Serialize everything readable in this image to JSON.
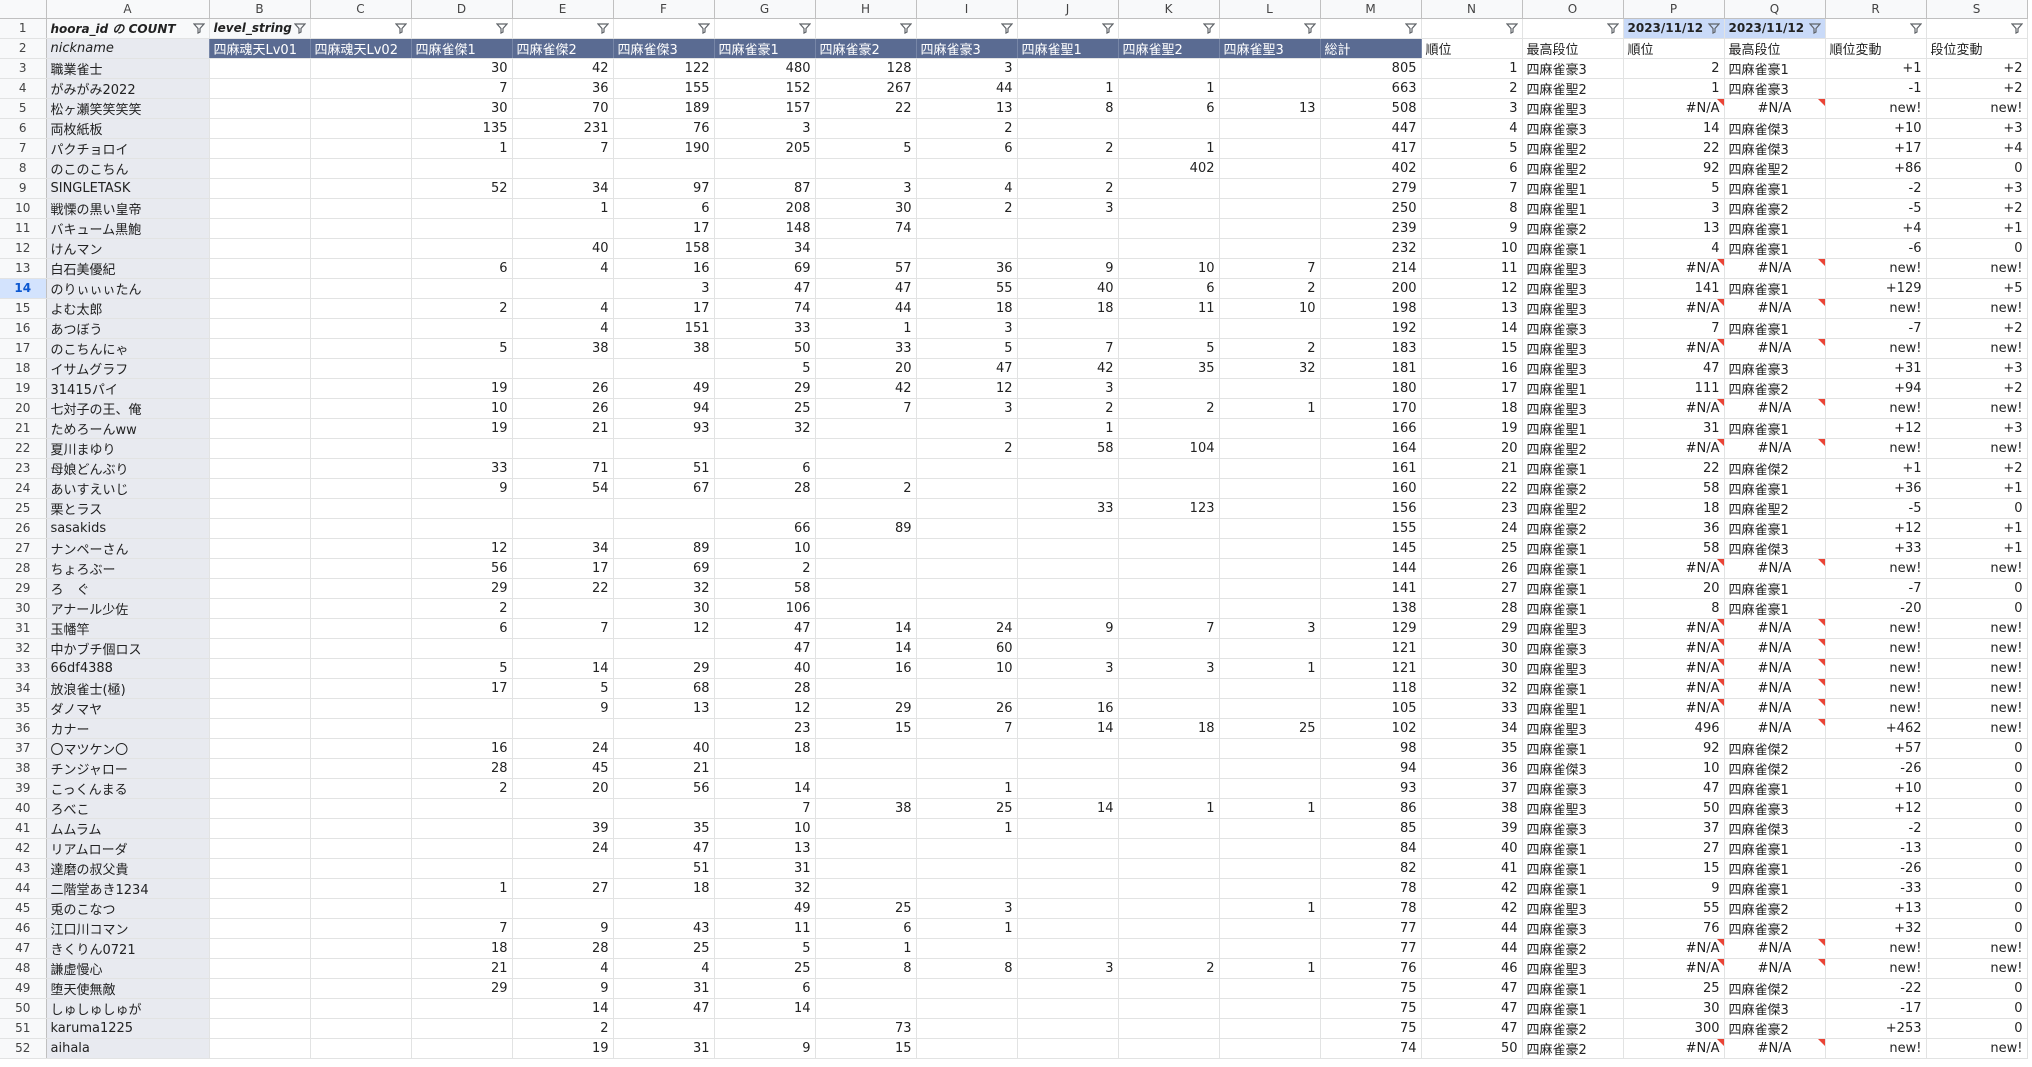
{
  "col_headers": [
    "A",
    "B",
    "C",
    "D",
    "E",
    "F",
    "G",
    "H",
    "I",
    "J",
    "K",
    "L",
    "M",
    "N",
    "O",
    "P",
    "Q",
    "R",
    "S"
  ],
  "row1": {
    "A": "hoora_id の COUNT",
    "B": "level_string",
    "P": "2023/11/12",
    "Q": "2023/11/12"
  },
  "row2": {
    "A": "nickname",
    "B": "四麻魂天Lv01",
    "C": "四麻魂天Lv02",
    "D": "四麻雀傑1",
    "E": "四麻雀傑2",
    "F": "四麻雀傑3",
    "G": "四麻雀豪1",
    "H": "四麻雀豪2",
    "I": "四麻雀豪3",
    "J": "四麻雀聖1",
    "K": "四麻雀聖2",
    "L": "四麻雀聖3",
    "M": "総計",
    "N": "順位",
    "O": "最高段位",
    "P": "順位",
    "Q": "最高段位",
    "R": "順位変動",
    "S": "段位変動"
  },
  "rows": [
    {
      "n": "3",
      "A": "職業雀士",
      "B": "",
      "C": "",
      "D": "30",
      "E": "42",
      "F": "122",
      "G": "480",
      "H": "128",
      "I": "3",
      "J": "",
      "K": "",
      "L": "",
      "M": "805",
      "N": "1",
      "O": "四麻雀豪3",
      "P": "2",
      "Q": "四麻雀豪1",
      "R": "+1",
      "S": "+2"
    },
    {
      "n": "4",
      "A": "がみがみ2022",
      "B": "",
      "C": "",
      "D": "7",
      "E": "36",
      "F": "155",
      "G": "152",
      "H": "267",
      "I": "44",
      "J": "1",
      "K": "1",
      "L": "",
      "M": "663",
      "N": "2",
      "O": "四麻雀聖2",
      "P": "1",
      "Q": "四麻雀豪3",
      "R": "-1",
      "S": "+2"
    },
    {
      "n": "5",
      "A": "松ヶ瀬笑笑笑笑",
      "B": "",
      "C": "",
      "D": "30",
      "E": "70",
      "F": "189",
      "G": "157",
      "H": "22",
      "I": "13",
      "J": "8",
      "K": "6",
      "L": "13",
      "M": "508",
      "N": "3",
      "O": "四麻雀聖3",
      "P": "#N/A",
      "Q": "#N/A",
      "R": "new!",
      "S": "new!"
    },
    {
      "n": "6",
      "A": "両枚紙板",
      "B": "",
      "C": "",
      "D": "135",
      "E": "231",
      "F": "76",
      "G": "3",
      "H": "",
      "I": "2",
      "J": "",
      "K": "",
      "L": "",
      "M": "447",
      "N": "4",
      "O": "四麻雀豪3",
      "P": "14",
      "Q": "四麻雀傑3",
      "R": "+10",
      "S": "+3"
    },
    {
      "n": "7",
      "A": "パクチョロイ",
      "B": "",
      "C": "",
      "D": "1",
      "E": "7",
      "F": "190",
      "G": "205",
      "H": "5",
      "I": "6",
      "J": "2",
      "K": "1",
      "L": "",
      "M": "417",
      "N": "5",
      "O": "四麻雀聖2",
      "P": "22",
      "Q": "四麻雀傑3",
      "R": "+17",
      "S": "+4"
    },
    {
      "n": "8",
      "A": "のこのこちん",
      "B": "",
      "C": "",
      "D": "",
      "E": "",
      "F": "",
      "G": "",
      "H": "",
      "I": "",
      "J": "",
      "K": "402",
      "L": "",
      "M": "402",
      "N": "6",
      "O": "四麻雀聖2",
      "P": "92",
      "Q": "四麻雀聖2",
      "R": "+86",
      "S": "0"
    },
    {
      "n": "9",
      "A": "SINGLETASK",
      "B": "",
      "C": "",
      "D": "52",
      "E": "34",
      "F": "97",
      "G": "87",
      "H": "3",
      "I": "4",
      "J": "2",
      "K": "",
      "L": "",
      "M": "279",
      "N": "7",
      "O": "四麻雀聖1",
      "P": "5",
      "Q": "四麻雀豪1",
      "R": "-2",
      "S": "+3"
    },
    {
      "n": "10",
      "A": "戦慄の黒い皇帝",
      "B": "",
      "C": "",
      "D": "",
      "E": "1",
      "F": "6",
      "G": "208",
      "H": "30",
      "I": "2",
      "J": "3",
      "K": "",
      "L": "",
      "M": "250",
      "N": "8",
      "O": "四麻雀聖1",
      "P": "3",
      "Q": "四麻雀豪2",
      "R": "-5",
      "S": "+2"
    },
    {
      "n": "11",
      "A": "バキューム黒鮑",
      "B": "",
      "C": "",
      "D": "",
      "E": "",
      "F": "17",
      "G": "148",
      "H": "74",
      "I": "",
      "J": "",
      "K": "",
      "L": "",
      "M": "239",
      "N": "9",
      "O": "四麻雀豪2",
      "P": "13",
      "Q": "四麻雀豪1",
      "R": "+4",
      "S": "+1"
    },
    {
      "n": "12",
      "A": "けんマン",
      "B": "",
      "C": "",
      "D": "",
      "E": "40",
      "F": "158",
      "G": "34",
      "H": "",
      "I": "",
      "J": "",
      "K": "",
      "L": "",
      "M": "232",
      "N": "10",
      "O": "四麻雀豪1",
      "P": "4",
      "Q": "四麻雀豪1",
      "R": "-6",
      "S": "0"
    },
    {
      "n": "13",
      "A": "白石美優紀",
      "B": "",
      "C": "",
      "D": "6",
      "E": "4",
      "F": "16",
      "G": "69",
      "H": "57",
      "I": "36",
      "J": "9",
      "K": "10",
      "L": "7",
      "M": "214",
      "N": "11",
      "O": "四麻雀聖3",
      "P": "#N/A",
      "Q": "#N/A",
      "R": "new!",
      "S": "new!"
    },
    {
      "n": "14",
      "A": "のりぃぃぃたん",
      "B": "",
      "C": "",
      "D": "",
      "E": "",
      "F": "3",
      "G": "47",
      "H": "47",
      "I": "55",
      "J": "40",
      "K": "6",
      "L": "2",
      "M": "200",
      "N": "12",
      "O": "四麻雀聖3",
      "P": "141",
      "Q": "四麻雀豪1",
      "R": "+129",
      "S": "+5"
    },
    {
      "n": "15",
      "A": "よむ太郎",
      "B": "",
      "C": "",
      "D": "2",
      "E": "4",
      "F": "17",
      "G": "74",
      "H": "44",
      "I": "18",
      "J": "18",
      "K": "11",
      "L": "10",
      "M": "198",
      "N": "13",
      "O": "四麻雀聖3",
      "P": "#N/A",
      "Q": "#N/A",
      "R": "new!",
      "S": "new!"
    },
    {
      "n": "16",
      "A": "あつぼう",
      "B": "",
      "C": "",
      "D": "",
      "E": "4",
      "F": "151",
      "G": "33",
      "H": "1",
      "I": "3",
      "J": "",
      "K": "",
      "L": "",
      "M": "192",
      "N": "14",
      "O": "四麻雀豪3",
      "P": "7",
      "Q": "四麻雀豪1",
      "R": "-7",
      "S": "+2"
    },
    {
      "n": "17",
      "A": "のこちんにゃ",
      "B": "",
      "C": "",
      "D": "5",
      "E": "38",
      "F": "38",
      "G": "50",
      "H": "33",
      "I": "5",
      "J": "7",
      "K": "5",
      "L": "2",
      "M": "183",
      "N": "15",
      "O": "四麻雀聖3",
      "P": "#N/A",
      "Q": "#N/A",
      "R": "new!",
      "S": "new!"
    },
    {
      "n": "18",
      "A": "イサムグラフ",
      "B": "",
      "C": "",
      "D": "",
      "E": "",
      "F": "",
      "G": "5",
      "H": "20",
      "I": "47",
      "J": "42",
      "K": "35",
      "L": "32",
      "M": "181",
      "N": "16",
      "O": "四麻雀聖3",
      "P": "47",
      "Q": "四麻雀豪3",
      "R": "+31",
      "S": "+3"
    },
    {
      "n": "19",
      "A": "31415パイ",
      "B": "",
      "C": "",
      "D": "19",
      "E": "26",
      "F": "49",
      "G": "29",
      "H": "42",
      "I": "12",
      "J": "3",
      "K": "",
      "L": "",
      "M": "180",
      "N": "17",
      "O": "四麻雀聖1",
      "P": "111",
      "Q": "四麻雀豪2",
      "R": "+94",
      "S": "+2"
    },
    {
      "n": "20",
      "A": "七対子の王、俺",
      "B": "",
      "C": "",
      "D": "10",
      "E": "26",
      "F": "94",
      "G": "25",
      "H": "7",
      "I": "3",
      "J": "2",
      "K": "2",
      "L": "1",
      "M": "170",
      "N": "18",
      "O": "四麻雀聖3",
      "P": "#N/A",
      "Q": "#N/A",
      "R": "new!",
      "S": "new!"
    },
    {
      "n": "21",
      "A": "ためろーんww",
      "B": "",
      "C": "",
      "D": "19",
      "E": "21",
      "F": "93",
      "G": "32",
      "H": "",
      "I": "",
      "J": "1",
      "K": "",
      "L": "",
      "M": "166",
      "N": "19",
      "O": "四麻雀聖1",
      "P": "31",
      "Q": "四麻雀豪1",
      "R": "+12",
      "S": "+3"
    },
    {
      "n": "22",
      "A": "夏川まゆり",
      "B": "",
      "C": "",
      "D": "",
      "E": "",
      "F": "",
      "G": "",
      "H": "",
      "I": "2",
      "J": "58",
      "K": "104",
      "L": "",
      "M": "164",
      "N": "20",
      "O": "四麻雀聖2",
      "P": "#N/A",
      "Q": "#N/A",
      "R": "new!",
      "S": "new!"
    },
    {
      "n": "23",
      "A": "母娘どんぶり",
      "B": "",
      "C": "",
      "D": "33",
      "E": "71",
      "F": "51",
      "G": "6",
      "H": "",
      "I": "",
      "J": "",
      "K": "",
      "L": "",
      "M": "161",
      "N": "21",
      "O": "四麻雀豪1",
      "P": "22",
      "Q": "四麻雀傑2",
      "R": "+1",
      "S": "+2"
    },
    {
      "n": "24",
      "A": "あいすえいじ",
      "B": "",
      "C": "",
      "D": "9",
      "E": "54",
      "F": "67",
      "G": "28",
      "H": "2",
      "I": "",
      "J": "",
      "K": "",
      "L": "",
      "M": "160",
      "N": "22",
      "O": "四麻雀豪2",
      "P": "58",
      "Q": "四麻雀豪1",
      "R": "+36",
      "S": "+1"
    },
    {
      "n": "25",
      "A": "栗とラス",
      "B": "",
      "C": "",
      "D": "",
      "E": "",
      "F": "",
      "G": "",
      "H": "",
      "I": "",
      "J": "33",
      "K": "123",
      "L": "",
      "M": "156",
      "N": "23",
      "O": "四麻雀聖2",
      "P": "18",
      "Q": "四麻雀聖2",
      "R": "-5",
      "S": "0"
    },
    {
      "n": "26",
      "A": "sasakids",
      "B": "",
      "C": "",
      "D": "",
      "E": "",
      "F": "",
      "G": "66",
      "H": "89",
      "I": "",
      "J": "",
      "K": "",
      "L": "",
      "M": "155",
      "N": "24",
      "O": "四麻雀豪2",
      "P": "36",
      "Q": "四麻雀豪1",
      "R": "+12",
      "S": "+1"
    },
    {
      "n": "27",
      "A": "ナンペーさん",
      "B": "",
      "C": "",
      "D": "12",
      "E": "34",
      "F": "89",
      "G": "10",
      "H": "",
      "I": "",
      "J": "",
      "K": "",
      "L": "",
      "M": "145",
      "N": "25",
      "O": "四麻雀豪1",
      "P": "58",
      "Q": "四麻雀傑3",
      "R": "+33",
      "S": "+1"
    },
    {
      "n": "28",
      "A": "ちょろぶー",
      "B": "",
      "C": "",
      "D": "56",
      "E": "17",
      "F": "69",
      "G": "2",
      "H": "",
      "I": "",
      "J": "",
      "K": "",
      "L": "",
      "M": "144",
      "N": "26",
      "O": "四麻雀豪1",
      "P": "#N/A",
      "Q": "#N/A",
      "R": "new!",
      "S": "new!"
    },
    {
      "n": "29",
      "A": "ろ　ぐ",
      "B": "",
      "C": "",
      "D": "29",
      "E": "22",
      "F": "32",
      "G": "58",
      "H": "",
      "I": "",
      "J": "",
      "K": "",
      "L": "",
      "M": "141",
      "N": "27",
      "O": "四麻雀豪1",
      "P": "20",
      "Q": "四麻雀豪1",
      "R": "-7",
      "S": "0"
    },
    {
      "n": "30",
      "A": "アナール少佐",
      "B": "",
      "C": "",
      "D": "2",
      "E": "",
      "F": "30",
      "G": "106",
      "H": "",
      "I": "",
      "J": "",
      "K": "",
      "L": "",
      "M": "138",
      "N": "28",
      "O": "四麻雀豪1",
      "P": "8",
      "Q": "四麻雀豪1",
      "R": "-20",
      "S": "0"
    },
    {
      "n": "31",
      "A": "玉幡竿",
      "B": "",
      "C": "",
      "D": "6",
      "E": "7",
      "F": "12",
      "G": "47",
      "H": "14",
      "I": "24",
      "J": "9",
      "K": "7",
      "L": "3",
      "M": "129",
      "N": "29",
      "O": "四麻雀聖3",
      "P": "#N/A",
      "Q": "#N/A",
      "R": "new!",
      "S": "new!"
    },
    {
      "n": "32",
      "A": "中かブチ個ロス",
      "B": "",
      "C": "",
      "D": "",
      "E": "",
      "F": "",
      "G": "47",
      "H": "14",
      "I": "60",
      "J": "",
      "K": "",
      "L": "",
      "M": "121",
      "N": "30",
      "O": "四麻雀豪3",
      "P": "#N/A",
      "Q": "#N/A",
      "R": "new!",
      "S": "new!"
    },
    {
      "n": "33",
      "A": "66df4388",
      "B": "",
      "C": "",
      "D": "5",
      "E": "14",
      "F": "29",
      "G": "40",
      "H": "16",
      "I": "10",
      "J": "3",
      "K": "3",
      "L": "1",
      "M": "121",
      "N": "30",
      "O": "四麻雀聖3",
      "P": "#N/A",
      "Q": "#N/A",
      "R": "new!",
      "S": "new!"
    },
    {
      "n": "34",
      "A": "放浪雀士(極)",
      "B": "",
      "C": "",
      "D": "17",
      "E": "5",
      "F": "68",
      "G": "28",
      "H": "",
      "I": "",
      "J": "",
      "K": "",
      "L": "",
      "M": "118",
      "N": "32",
      "O": "四麻雀豪1",
      "P": "#N/A",
      "Q": "#N/A",
      "R": "new!",
      "S": "new!"
    },
    {
      "n": "35",
      "A": "ダノマヤ",
      "B": "",
      "C": "",
      "D": "",
      "E": "9",
      "F": "13",
      "G": "12",
      "H": "29",
      "I": "26",
      "J": "16",
      "K": "",
      "L": "",
      "M": "105",
      "N": "33",
      "O": "四麻雀聖1",
      "P": "#N/A",
      "Q": "#N/A",
      "R": "new!",
      "S": "new!"
    },
    {
      "n": "36",
      "A": "カナー",
      "B": "",
      "C": "",
      "D": "",
      "E": "",
      "F": "",
      "G": "23",
      "H": "15",
      "I": "7",
      "J": "14",
      "K": "18",
      "L": "25",
      "M": "102",
      "N": "34",
      "O": "四麻雀聖3",
      "P": "496",
      "Q": "#N/A",
      "R": "+462",
      "S": "new!"
    },
    {
      "n": "37",
      "A": "〇マツケン〇",
      "B": "",
      "C": "",
      "D": "16",
      "E": "24",
      "F": "40",
      "G": "18",
      "H": "",
      "I": "",
      "J": "",
      "K": "",
      "L": "",
      "M": "98",
      "N": "35",
      "O": "四麻雀豪1",
      "P": "92",
      "Q": "四麻雀傑2",
      "R": "+57",
      "S": "0"
    },
    {
      "n": "38",
      "A": "チンジャロー",
      "B": "",
      "C": "",
      "D": "28",
      "E": "45",
      "F": "21",
      "G": "",
      "H": "",
      "I": "",
      "J": "",
      "K": "",
      "L": "",
      "M": "94",
      "N": "36",
      "O": "四麻雀傑3",
      "P": "10",
      "Q": "四麻雀傑2",
      "R": "-26",
      "S": "0"
    },
    {
      "n": "39",
      "A": "こっくんまる",
      "B": "",
      "C": "",
      "D": "2",
      "E": "20",
      "F": "56",
      "G": "14",
      "H": "",
      "I": "1",
      "J": "",
      "K": "",
      "L": "",
      "M": "93",
      "N": "37",
      "O": "四麻雀豪3",
      "P": "47",
      "Q": "四麻雀豪1",
      "R": "+10",
      "S": "0"
    },
    {
      "n": "40",
      "A": "ろべこ",
      "B": "",
      "C": "",
      "D": "",
      "E": "",
      "F": "",
      "G": "7",
      "H": "38",
      "I": "25",
      "J": "14",
      "K": "1",
      "L": "1",
      "M": "86",
      "N": "38",
      "O": "四麻雀聖3",
      "P": "50",
      "Q": "四麻雀豪3",
      "R": "+12",
      "S": "0"
    },
    {
      "n": "41",
      "A": "ムムラム",
      "B": "",
      "C": "",
      "D": "",
      "E": "39",
      "F": "35",
      "G": "10",
      "H": "",
      "I": "1",
      "J": "",
      "K": "",
      "L": "",
      "M": "85",
      "N": "39",
      "O": "四麻雀豪3",
      "P": "37",
      "Q": "四麻雀傑3",
      "R": "-2",
      "S": "0"
    },
    {
      "n": "42",
      "A": "リアムローダ",
      "B": "",
      "C": "",
      "D": "",
      "E": "24",
      "F": "47",
      "G": "13",
      "H": "",
      "I": "",
      "J": "",
      "K": "",
      "L": "",
      "M": "84",
      "N": "40",
      "O": "四麻雀豪1",
      "P": "27",
      "Q": "四麻雀豪1",
      "R": "-13",
      "S": "0"
    },
    {
      "n": "43",
      "A": "達磨の叔父貴",
      "B": "",
      "C": "",
      "D": "",
      "E": "",
      "F": "51",
      "G": "31",
      "H": "",
      "I": "",
      "J": "",
      "K": "",
      "L": "",
      "M": "82",
      "N": "41",
      "O": "四麻雀豪1",
      "P": "15",
      "Q": "四麻雀豪1",
      "R": "-26",
      "S": "0"
    },
    {
      "n": "44",
      "A": "二階堂あき1234",
      "B": "",
      "C": "",
      "D": "1",
      "E": "27",
      "F": "18",
      "G": "32",
      "H": "",
      "I": "",
      "J": "",
      "K": "",
      "L": "",
      "M": "78",
      "N": "42",
      "O": "四麻雀豪1",
      "P": "9",
      "Q": "四麻雀豪1",
      "R": "-33",
      "S": "0"
    },
    {
      "n": "45",
      "A": "兎のこなつ",
      "B": "",
      "C": "",
      "D": "",
      "E": "",
      "F": "",
      "G": "49",
      "H": "25",
      "I": "3",
      "J": "",
      "K": "",
      "L": "1",
      "M": "78",
      "N": "42",
      "O": "四麻雀聖3",
      "P": "55",
      "Q": "四麻雀豪2",
      "R": "+13",
      "S": "0"
    },
    {
      "n": "46",
      "A": "江口川コマン",
      "B": "",
      "C": "",
      "D": "7",
      "E": "9",
      "F": "43",
      "G": "11",
      "H": "6",
      "I": "1",
      "J": "",
      "K": "",
      "L": "",
      "M": "77",
      "N": "44",
      "O": "四麻雀豪3",
      "P": "76",
      "Q": "四麻雀豪2",
      "R": "+32",
      "S": "0"
    },
    {
      "n": "47",
      "A": "きくりん0721",
      "B": "",
      "C": "",
      "D": "18",
      "E": "28",
      "F": "25",
      "G": "5",
      "H": "1",
      "I": "",
      "J": "",
      "K": "",
      "L": "",
      "M": "77",
      "N": "44",
      "O": "四麻雀豪2",
      "P": "#N/A",
      "Q": "#N/A",
      "R": "new!",
      "S": "new!"
    },
    {
      "n": "48",
      "A": "謙虚慢心",
      "B": "",
      "C": "",
      "D": "21",
      "E": "4",
      "F": "4",
      "G": "25",
      "H": "8",
      "I": "8",
      "J": "3",
      "K": "2",
      "L": "1",
      "M": "76",
      "N": "46",
      "O": "四麻雀聖3",
      "P": "#N/A",
      "Q": "#N/A",
      "R": "new!",
      "S": "new!"
    },
    {
      "n": "49",
      "A": "堕天使無敵",
      "B": "",
      "C": "",
      "D": "29",
      "E": "9",
      "F": "31",
      "G": "6",
      "H": "",
      "I": "",
      "J": "",
      "K": "",
      "L": "",
      "M": "75",
      "N": "47",
      "O": "四麻雀豪1",
      "P": "25",
      "Q": "四麻雀傑2",
      "R": "-22",
      "S": "0"
    },
    {
      "n": "50",
      "A": "しゅしゅしゅが",
      "B": "",
      "C": "",
      "D": "",
      "E": "14",
      "F": "47",
      "G": "14",
      "H": "",
      "I": "",
      "J": "",
      "K": "",
      "L": "",
      "M": "75",
      "N": "47",
      "O": "四麻雀豪1",
      "P": "30",
      "Q": "四麻雀傑3",
      "R": "-17",
      "S": "0"
    },
    {
      "n": "51",
      "A": "karuma1225",
      "B": "",
      "C": "",
      "D": "",
      "E": "2",
      "F": "",
      "G": "",
      "H": "73",
      "I": "",
      "J": "",
      "K": "",
      "L": "",
      "M": "75",
      "N": "47",
      "O": "四麻雀豪2",
      "P": "300",
      "Q": "四麻雀豪2",
      "R": "+253",
      "S": "0"
    },
    {
      "n": "52",
      "A": "aihala",
      "B": "",
      "C": "",
      "D": "",
      "E": "19",
      "F": "31",
      "G": "9",
      "H": "15",
      "I": "",
      "J": "",
      "K": "",
      "L": "",
      "M": "74",
      "N": "50",
      "O": "四麻雀豪2",
      "P": "#N/A",
      "Q": "#N/A",
      "R": "new!",
      "S": "new!"
    }
  ],
  "selected_row": "14",
  "filter_icon": "filter-icon",
  "colors": {
    "header_bg": "#5a6b92",
    "date_bg": "#c9daf8",
    "nickname_bg": "#e8eaf0",
    "error_flag": "#ea4335"
  }
}
